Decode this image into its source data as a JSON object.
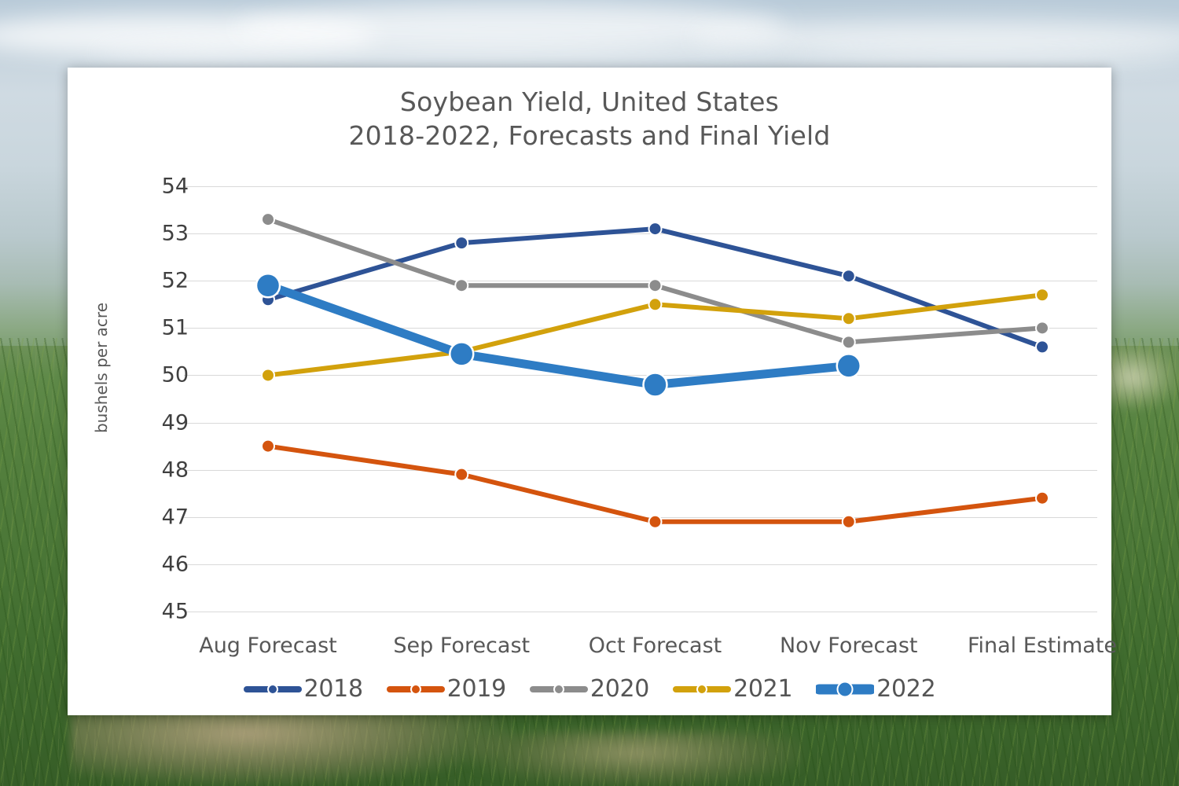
{
  "chart_data": {
    "type": "line",
    "title": "Soybean Yield, United States",
    "subtitle": "2018-2022, Forecasts and Final Yield",
    "xlabel": "",
    "ylabel": "bushels per acre",
    "categories": [
      "Aug Forecast",
      "Sep Forecast",
      "Oct Forecast",
      "Nov Forecast",
      "Final Estimate"
    ],
    "ylim": [
      45,
      54
    ],
    "yticks": [
      45,
      46,
      47,
      48,
      49,
      50,
      51,
      52,
      53,
      54
    ],
    "grid": true,
    "legend_position": "bottom",
    "series": [
      {
        "name": "2018",
        "color": "#2E5396",
        "emphasis": false,
        "values": [
          51.6,
          52.8,
          53.1,
          52.1,
          50.6
        ]
      },
      {
        "name": "2019",
        "color": "#D4540E",
        "emphasis": false,
        "values": [
          48.5,
          47.9,
          46.9,
          46.9,
          47.4
        ]
      },
      {
        "name": "2020",
        "color": "#8C8C8C",
        "emphasis": false,
        "values": [
          53.3,
          51.9,
          51.9,
          50.7,
          51.0
        ]
      },
      {
        "name": "2021",
        "color": "#D2A10C",
        "emphasis": false,
        "values": [
          50.0,
          50.5,
          51.5,
          51.2,
          51.7
        ]
      },
      {
        "name": "2022",
        "color": "#2E7CC4",
        "emphasis": true,
        "values": [
          51.9,
          50.45,
          49.8,
          50.2,
          null
        ]
      }
    ]
  },
  "colors": {
    "grid": "#d9d9d9",
    "tick_text": "#404040",
    "title_text": "#585858",
    "card_background": "#ffffff"
  }
}
